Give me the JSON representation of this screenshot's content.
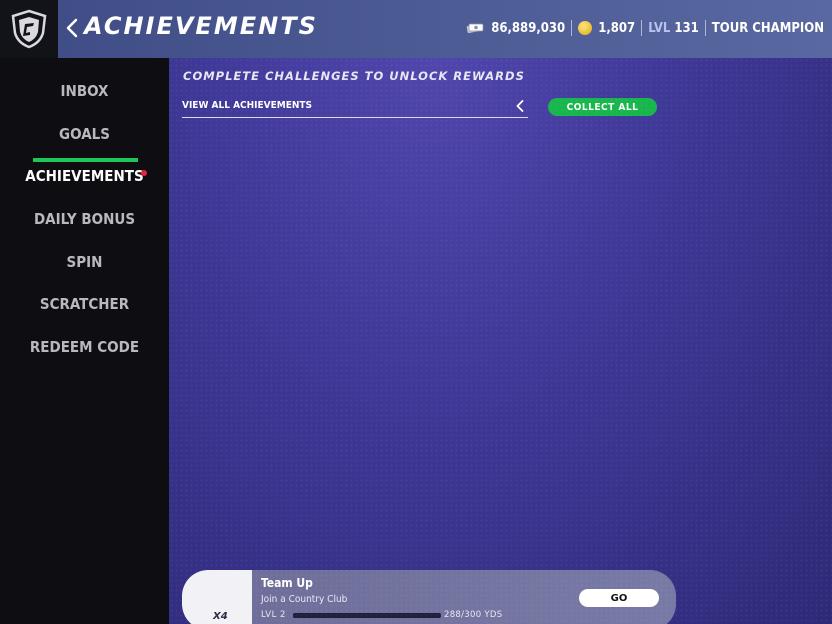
{
  "header": {
    "title": "ACHIEVEMENTS",
    "cash": "86,889,030",
    "coins": "1,807",
    "level_label": "LVL",
    "level_value": "131",
    "rank": "TOUR CHAMPION"
  },
  "sidebar": {
    "items": [
      {
        "label": "INBOX"
      },
      {
        "label": "GOALS"
      },
      {
        "label": "ACHIEVEMENTS",
        "active": true,
        "has_notification": true
      },
      {
        "label": "DAILY BONUS"
      },
      {
        "label": "SPIN"
      },
      {
        "label": "SCRATCHER"
      },
      {
        "label": "REDEEM CODE"
      }
    ]
  },
  "main": {
    "subtitle": "COMPLETE CHALLENGES TO UNLOCK REWARDS",
    "filter": {
      "selected": "VIEW ALL ACHIEVEMENTS"
    },
    "collect_all_label": "COLLECT ALL"
  },
  "achievement_card": {
    "multiplier": "X4",
    "title": "Team Up",
    "description": "Join a Country Club",
    "level": "LVL 2",
    "progress_text": "288/300 YDS",
    "progress_fraction": 0.96,
    "go_label": "GO"
  },
  "colors": {
    "accent_green": "#1ec657",
    "notification_red": "#e8243c",
    "header_blue": "#4e5c96",
    "main_purple": "#3f3998"
  }
}
